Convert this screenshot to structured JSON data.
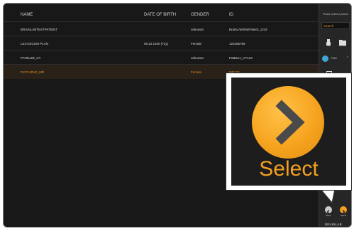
{
  "table": {
    "headers": [
      "NAME",
      "DATE OF BIRTH",
      "GENDER",
      "ID"
    ],
    "rows": [
      {
        "name": "BRAINLABTESTPATIENT",
        "dob": "",
        "gender": "unknown",
        "id": "BrainLABTestPatient_1234"
      },
      {
        "name": "LEXI DICOM PLAN",
        "dob": "09.12.1940 (71y)",
        "gender": "Female",
        "id": "123456789"
      },
      {
        "name": "PATBUZZ_CT",
        "dob": "",
        "gender": "unknown",
        "id": "PatBuzz_CT123"
      },
      {
        "name": "PATCURVE_MR",
        "dob": "",
        "gender": "Female",
        "id": "MR123"
      }
    ],
    "selected_row": 3
  },
  "sidebar": {
    "prompt": "Please select a patient",
    "search_placeholder": "Search",
    "buttons": [
      {
        "label": "Disk",
        "icon": "usb-icon"
      },
      {
        "label": "Browse",
        "icon": "folder-icon"
      }
    ],
    "filter_label": "Filter",
    "option_label": "Database"
  },
  "nav": {
    "back_label": "Back",
    "select_label": "Select"
  },
  "brand": "BRAINLAB",
  "callout": {
    "label": "Select"
  },
  "colors": {
    "accent": "#f3a020",
    "background": "#1c1c1c",
    "filter_dot": "#3fa6d8"
  }
}
